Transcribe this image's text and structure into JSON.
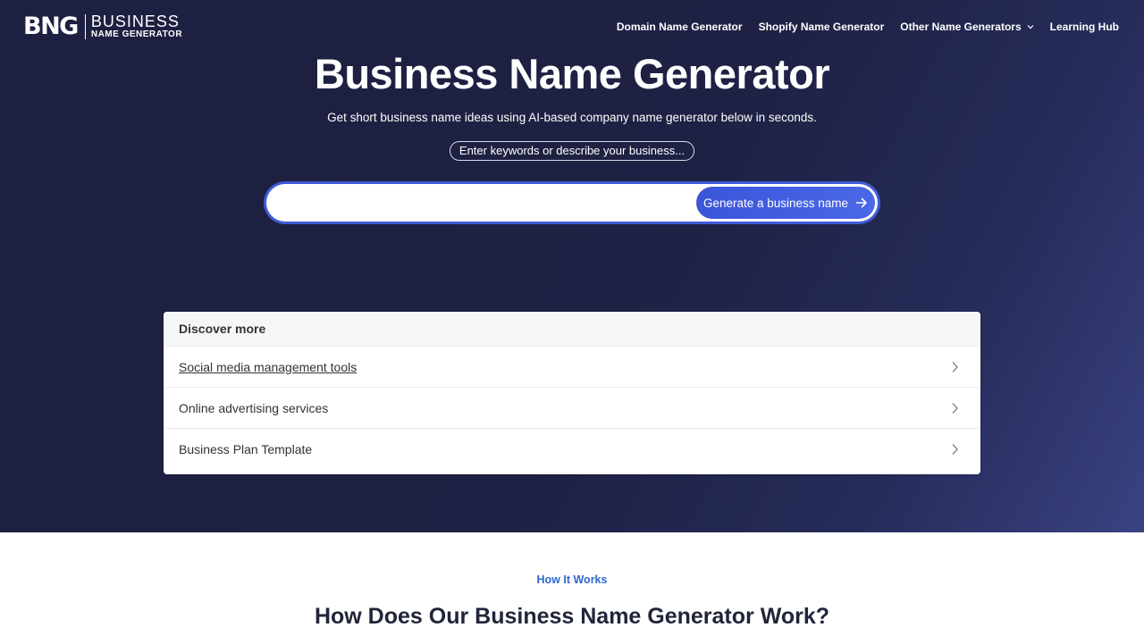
{
  "header": {
    "logo_mark": "BNG",
    "logo_line1": "BUSINESS",
    "logo_line2": "NAME GENERATOR",
    "nav": [
      {
        "label": "Domain Name Generator"
      },
      {
        "label": "Shopify Name Generator"
      },
      {
        "label": "Other Name Generators",
        "has_dropdown": true,
        "icon": "chevron-down-icon"
      },
      {
        "label": "Learning Hub"
      }
    ]
  },
  "hero": {
    "title": "Business Name Generator",
    "subtitle": "Get short business name ideas using AI-based company name generator below in seconds.",
    "hint": "Enter keywords or describe your business...",
    "search": {
      "value": "",
      "placeholder": ""
    },
    "generate_label": "Generate a business name",
    "generate_icon": "arrow-right-icon"
  },
  "discover": {
    "heading": "Discover more",
    "items": [
      {
        "label": "Social media management tools",
        "icon": "chevron-right-icon"
      },
      {
        "label": "Online advertising services",
        "icon": "chevron-right-icon"
      },
      {
        "label": "Business Plan Template",
        "icon": "chevron-right-icon"
      }
    ]
  },
  "how_it_works": {
    "tag": "How It Works",
    "title": "How Does Our Business Name Generator Work?"
  },
  "colors": {
    "hero_bg": "#1d2040",
    "accent": "#3f5bd8",
    "link_blue": "#2f67c9"
  }
}
